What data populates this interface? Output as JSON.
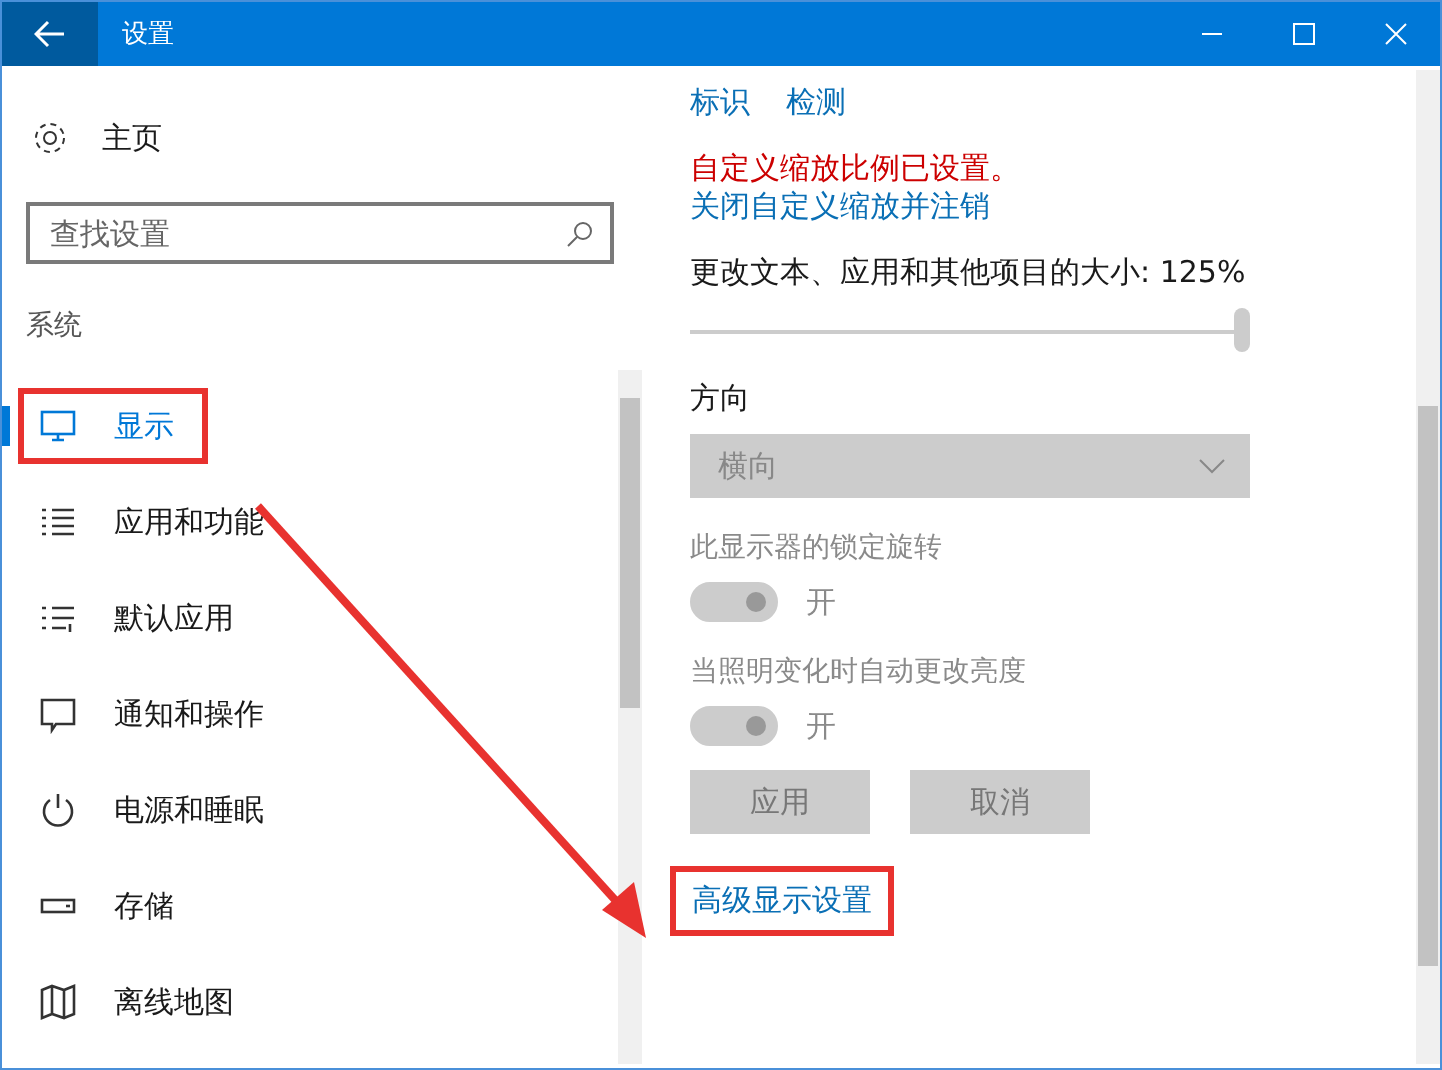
{
  "window": {
    "title": "设置"
  },
  "sidebar": {
    "home": "主页",
    "search": {
      "placeholder": "查找设置"
    },
    "section": "系统",
    "items": [
      {
        "label": "显示",
        "kind": "monitor",
        "selected": true,
        "highlighted": true
      },
      {
        "label": "应用和功能",
        "kind": "list",
        "selected": false,
        "highlighted": false
      },
      {
        "label": "默认应用",
        "kind": "default",
        "selected": false,
        "highlighted": false
      },
      {
        "label": "通知和操作",
        "kind": "message",
        "selected": false,
        "highlighted": false
      },
      {
        "label": "电源和睡眠",
        "kind": "power",
        "selected": false,
        "highlighted": false
      },
      {
        "label": "存储",
        "kind": "drive",
        "selected": false,
        "highlighted": false
      },
      {
        "label": "离线地图",
        "kind": "map",
        "selected": false,
        "highlighted": false
      }
    ]
  },
  "content": {
    "links": [
      "标识",
      "检测"
    ],
    "warning": "自定义缩放比例已设置。",
    "signout_link": "关闭自定义缩放并注销",
    "scale": {
      "label": "更改文本、应用和其他项目的大小: 125%",
      "level": 1,
      "disabled": true
    },
    "orientation": {
      "label": "方向",
      "value": "横向",
      "disabled": true
    },
    "toggles": [
      {
        "label": "此显示器的锁定旋转",
        "state": "开",
        "on": true,
        "disabled": true
      },
      {
        "label": "当照明变化时自动更改亮度",
        "state": "开",
        "on": true,
        "disabled": true
      }
    ],
    "buttons": [
      {
        "label": "应用",
        "disabled": true
      },
      {
        "label": "取消",
        "disabled": true
      }
    ],
    "advanced_link": {
      "label": "高级显示设置",
      "highlighted": true
    }
  }
}
